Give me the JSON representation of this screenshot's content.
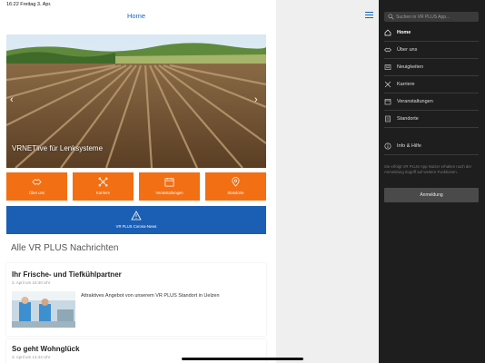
{
  "status_bar": {
    "time_date": "16:22  Freitag 3. Apr."
  },
  "header": {
    "title": "Home"
  },
  "hero": {
    "caption": "VRNETlive für Lenksysteme",
    "prev_icon": "chevron-left-icon",
    "next_icon": "chevron-right-icon"
  },
  "tiles": [
    {
      "label": "Über uns",
      "icon": "handshake-icon"
    },
    {
      "label": "Karriere",
      "icon": "network-icon"
    },
    {
      "label": "Veranstaltungen",
      "icon": "calendar-icon"
    },
    {
      "label": "Standorte",
      "icon": "location-pin-icon"
    }
  ],
  "corona": {
    "label": "VR PLUS Corona-News",
    "icon": "warning-icon"
  },
  "news": {
    "section_title": "Alle VR PLUS Nachrichten",
    "items": [
      {
        "title": "Ihr Frische- und Tiefkühlpartner",
        "date": "3. April um 15:40 Uhr",
        "text": "Attraktives Angebot von unserem VR PLUS Standort in Uelzen"
      },
      {
        "title": "So geht Wohnglück",
        "date": "3. April um 14:44 Uhr"
      }
    ]
  },
  "drawer": {
    "search_placeholder": "Suchen in VR PLUS App...",
    "items": [
      {
        "label": "Home",
        "icon": "home-icon",
        "active": true
      },
      {
        "label": "Über uns",
        "icon": "handshake-icon"
      },
      {
        "label": "Neuigkeiten",
        "icon": "newspaper-icon"
      },
      {
        "label": "Karriere",
        "icon": "network-icon"
      },
      {
        "label": "Veranstaltungen",
        "icon": "calendar-icon"
      },
      {
        "label": "Standorte",
        "icon": "location-pin-icon"
      }
    ],
    "info": {
      "label": "Info & Hilfe",
      "icon": "info-icon"
    },
    "login_note": "Sie erfolgt VR PLUS App Nutzer erhalten nach der Anmeldung Zugriff auf weitere Funktionen.",
    "login_button": "Anmeldung"
  },
  "colors": {
    "orange": "#f26f14",
    "blue": "#1b5fb4",
    "drawer_bg": "#1e1e1e"
  }
}
